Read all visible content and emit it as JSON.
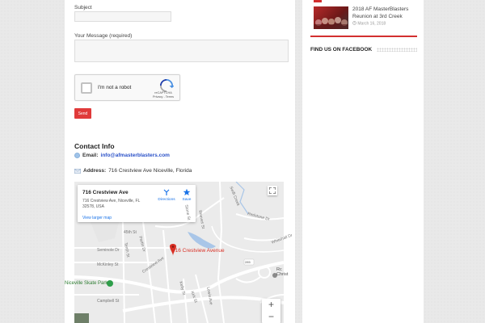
{
  "form": {
    "subject_label": "Subject",
    "subject_value": "",
    "message_label": "Your Message (required)",
    "message_value": "",
    "captcha_text": "I'm not a robot",
    "captcha_brand": "reCAPTCHA",
    "captcha_links": "Privacy - Terms",
    "send_label": "Send"
  },
  "contact": {
    "heading": "Contact Info",
    "email_label": "Email:",
    "email_value": "info@afmasterblasters.com",
    "address_label": "Address:",
    "address_value": "716 Crestview Ave Niceville, Florida"
  },
  "map": {
    "place_name": "716 Crestview Ave",
    "place_address": "716 Crestview Ave, Niceville, FL 32578, USA",
    "larger_map_link": "View larger map",
    "directions_label": "Directions",
    "save_label": "Save",
    "pin_label": "716 Crestview Avenue",
    "poi_skate_park": "Niceville Skate Park",
    "poi_church": "Rc\nChrist",
    "zoom_in": "+",
    "zoom_out": "−",
    "streets": {
      "s1": "Swift Creek",
      "s2": "45th St",
      "s3": "Seminole Dr",
      "s4": "McKinley St",
      "s5": "Campbell St",
      "s6": "Crestview Ave",
      "s7": "Partin Dr",
      "s8": "Tenth St",
      "s9": "Kelly St",
      "s10": "Kirk St",
      "s11": "Lewis Ave",
      "s12": "Reeves St",
      "s13": "Stone St",
      "s14": "Redstone Dr",
      "s15": "Whitehall Dr",
      "route": "285"
    }
  },
  "sidebar": {
    "post_title": "2018 AF MasterBlasters Reunion at 3rd Creek",
    "post_date": "March 16, 2018",
    "facebook_heading": "FIND US ON FACEBOOK"
  },
  "colors": {
    "accent": "#e03a3a",
    "link": "#2a51c8",
    "pin": "#d93025"
  }
}
